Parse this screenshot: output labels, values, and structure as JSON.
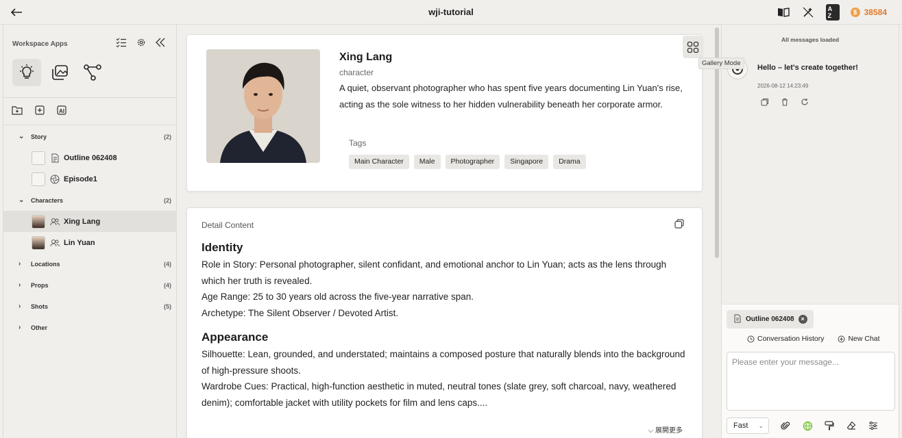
{
  "header": {
    "title": "wji-tutorial",
    "back_icon": "arrow-left-icon",
    "coins": "38584",
    "az_label": "A Z"
  },
  "sidebar": {
    "workspace_label": "Workspace Apps",
    "categories": [
      {
        "label": "Story",
        "count": "(2)",
        "expanded": true
      },
      {
        "label": "Characters",
        "count": "(2)",
        "expanded": true
      },
      {
        "label": "Locations",
        "count": "(4)",
        "expanded": false
      },
      {
        "label": "Props",
        "count": "(4)",
        "expanded": false
      },
      {
        "label": "Shots",
        "count": "(5)",
        "expanded": false
      },
      {
        "label": "Other",
        "count": "",
        "expanded": false
      }
    ],
    "story_items": [
      "Outline 062408",
      "Episode1"
    ],
    "character_items": [
      "Xing Lang",
      "Lin Yuan"
    ]
  },
  "profile": {
    "name": "Xing Lang",
    "type": "character",
    "description": "A quiet, observant photographer who has spent five years documenting Lin Yuan's rise, acting as the sole witness to her hidden vulnerability beneath her corporate armor.",
    "tags_label": "Tags",
    "tags": [
      "Main Character",
      "Male",
      "Photographer",
      "Singapore",
      "Drama"
    ],
    "tooltip": "Gallery Mode"
  },
  "detail": {
    "header": "Detail Content",
    "identity_title": "Identity",
    "identity_lines": [
      "Role in Story: Personal photographer, silent confidant, and emotional anchor to Lin Yuan; acts as the lens through which her truth is revealed.",
      "Age Range: 25 to 30 years old across the five-year narrative span.",
      "Archetype: The Silent Observer / Devoted Artist."
    ],
    "appearance_title": "Appearance",
    "appearance_lines": [
      "Silhouette: Lean, grounded, and understated; maintains a composed posture that naturally blends into the background of high-pressure shoots.",
      "Wardrobe Cues: Practical, high-function aesthetic in muted, neutral tones (slate grey, soft charcoal, navy, weathered denim); comfortable jacket with utility pockets for film and lens caps...."
    ],
    "expand_label": "展開更多"
  },
  "chat": {
    "loaded_text": "All messages loaded",
    "greeting": "Hello – let's create together!",
    "timestamp": "2026-08-12 14:23:49",
    "context_chip": "Outline 062408",
    "history_label": "Conversation History",
    "new_chat_label": "New Chat",
    "input_placeholder": "Please enter your message...",
    "mode_value": "Fast"
  },
  "colors": {
    "coin_orange": "#e07a2a",
    "accent_green": "#7cc242"
  }
}
